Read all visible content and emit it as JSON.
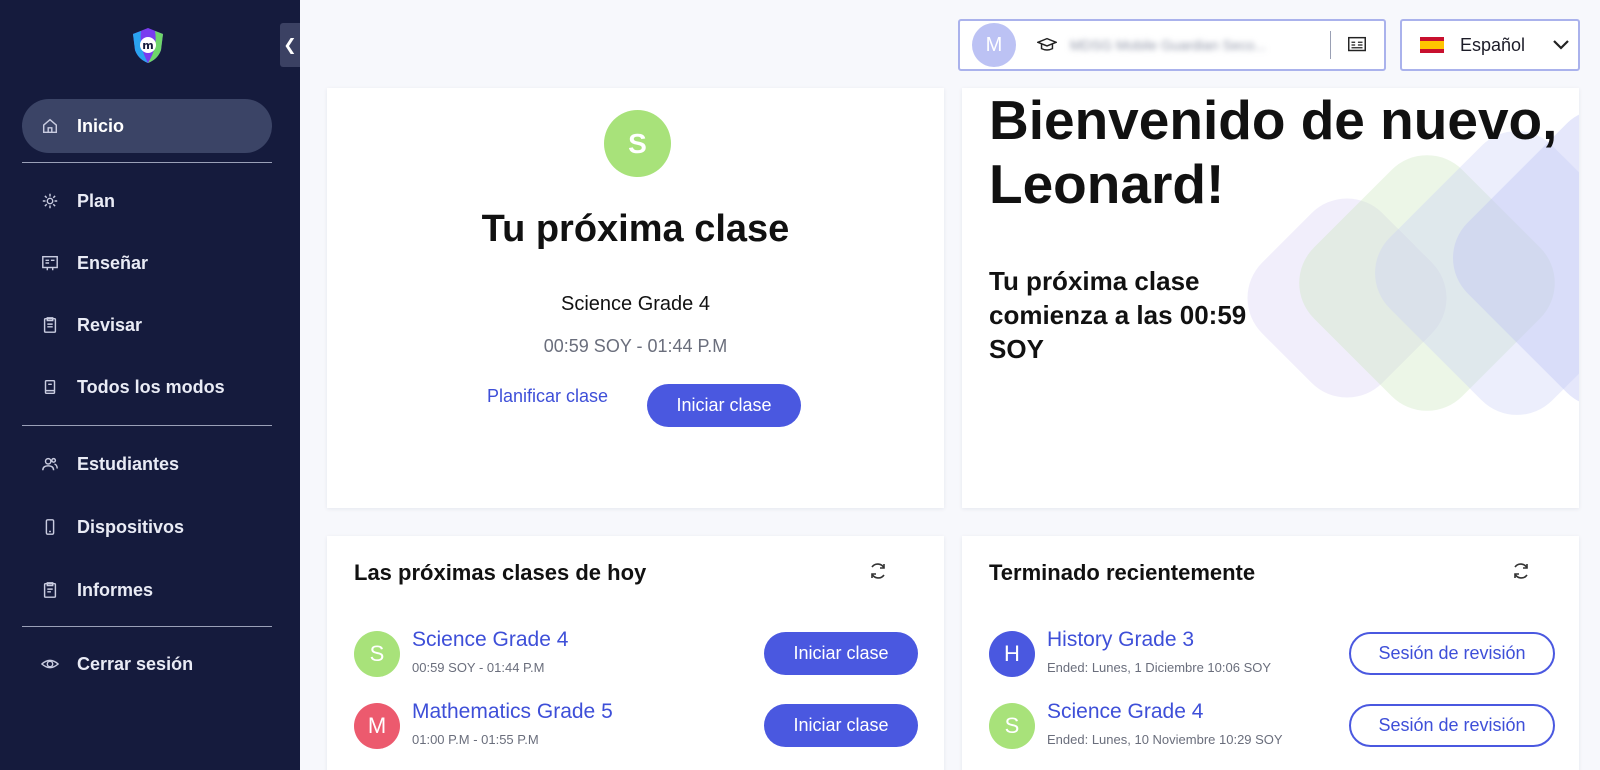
{
  "sidebar": {
    "collapse_glyph": "❮",
    "items": [
      {
        "label": "Inicio",
        "icon": "home-icon"
      },
      {
        "label": "Plan",
        "icon": "gear-icon"
      },
      {
        "label": "Enseñar",
        "icon": "board-icon"
      },
      {
        "label": "Revisar",
        "icon": "clipboard-icon"
      },
      {
        "label": "Todos los modos",
        "icon": "book-icon"
      },
      {
        "label": "Estudiantes",
        "icon": "users-icon"
      },
      {
        "label": "Dispositivos",
        "icon": "phone-icon"
      },
      {
        "label": "Informes",
        "icon": "report-icon"
      },
      {
        "label": "Cerrar sesión",
        "icon": "eye-icon"
      }
    ]
  },
  "header": {
    "user_initial": "M",
    "school_name": "MDSG Mobile Guardian Seco...",
    "language": "Español"
  },
  "next_class": {
    "avatar_letter": "S",
    "title": "Tu próxima clase",
    "class_name": "Science Grade 4",
    "time": "00:59 SOY - 01:44 P.M",
    "plan_label": "Planificar clase",
    "start_label": "Iniciar clase"
  },
  "welcome": {
    "title": "Bienvenido de nuevo, Leonard!",
    "subtitle": "Tu próxima clase comienza a las 00:59 SOY"
  },
  "today": {
    "title": "Las próximas clases de hoy",
    "items": [
      {
        "letter": "S",
        "color": "#a8e27a",
        "name": "Science Grade 4",
        "time": "00:59 SOY - 01:44 P.M",
        "button": "Iniciar clase"
      },
      {
        "letter": "M",
        "color": "#ec5a6e",
        "name": "Mathematics Grade 5",
        "time": "01:00 P.M - 01:55 P.M",
        "button": "Iniciar clase"
      }
    ]
  },
  "recent": {
    "title": "Terminado recientemente",
    "items": [
      {
        "letter": "H",
        "color": "#4a58e0",
        "name": "History Grade 3",
        "ended": "Ended: Lunes, 1 Diciembre 10:06 SOY",
        "button": "Sesión de revisión"
      },
      {
        "letter": "S",
        "color": "#a8e27a",
        "name": "Science Grade 4",
        "ended": "Ended: Lunes, 10 Noviembre 10:29 SOY",
        "button": "Sesión de revisión"
      }
    ]
  },
  "colors": {
    "sidebar_bg": "#151b3d",
    "accent": "#4a58e0",
    "active_item": "#3b4466"
  }
}
